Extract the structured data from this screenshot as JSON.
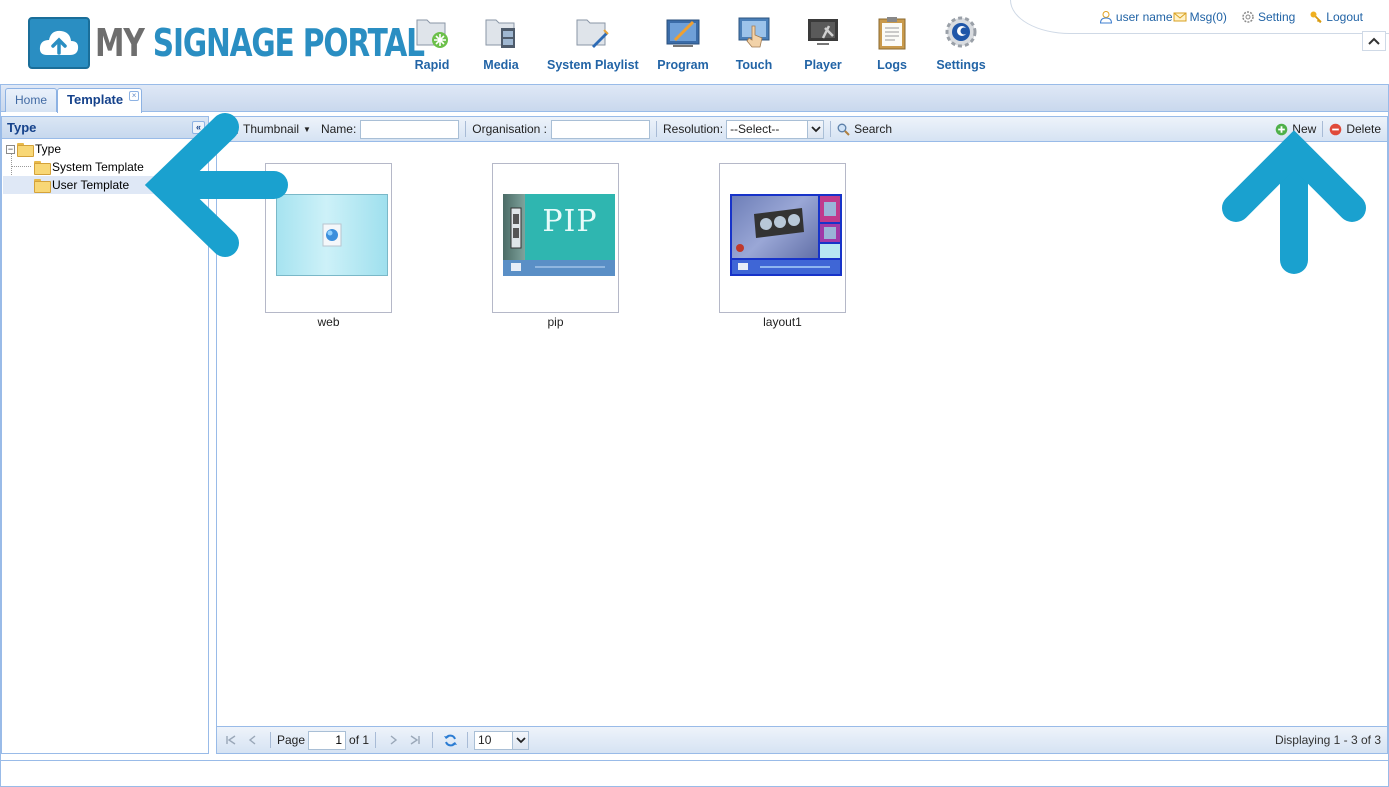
{
  "brand": {
    "part1": "MY",
    "part2": "SIGNAGE PORTAL"
  },
  "nav": [
    {
      "label": "Rapid",
      "icon": "rapid-folder-icon"
    },
    {
      "label": "Media",
      "icon": "media-film-icon"
    },
    {
      "label": "System Playlist",
      "icon": "system-playlist-icon"
    },
    {
      "label": "Program",
      "icon": "program-icon"
    },
    {
      "label": "Touch",
      "icon": "touch-icon"
    },
    {
      "label": "Player",
      "icon": "player-icon"
    },
    {
      "label": "Logs",
      "icon": "logs-clipboard-icon"
    },
    {
      "label": "Settings",
      "icon": "settings-gear-icon"
    }
  ],
  "top_links": {
    "user": "user name",
    "msg": "Msg(0)",
    "setting": "Setting",
    "logout": "Logout"
  },
  "tabs": [
    {
      "label": "Home"
    },
    {
      "label": "Template"
    }
  ],
  "left": {
    "title": "Type",
    "tree": [
      {
        "label": "Type"
      },
      {
        "label": "System Template"
      },
      {
        "label": "User Template"
      }
    ]
  },
  "toolbar": {
    "view_mode": "Thumbnail",
    "name_label": "Name:",
    "name_value": "",
    "org_label": "Organisation :",
    "org_value": "",
    "resolution_label": "Resolution:",
    "resolution_value": "--Select--",
    "search": "Search",
    "new": "New",
    "delete": "Delete"
  },
  "templates": [
    {
      "name": "web"
    },
    {
      "name": "pip",
      "thumb_text": "PIP"
    },
    {
      "name": "layout1"
    }
  ],
  "pager": {
    "page_label": "Page",
    "page_value": "1",
    "of_label": "of 1",
    "page_size": "10",
    "display": "Displaying 1 - 3 of 3"
  },
  "colors": {
    "accent": "#2264a6",
    "arrow": "#1aa1cf",
    "panel_border": "#99bbe8"
  }
}
